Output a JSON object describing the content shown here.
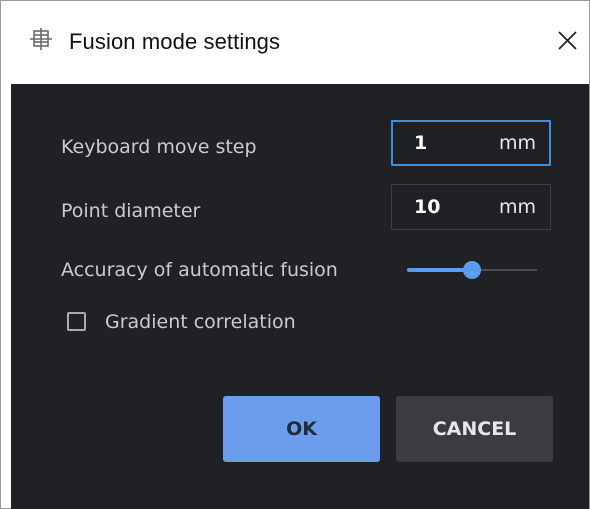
{
  "dialog": {
    "title": "Fusion mode settings",
    "icon": "fusion-crosshair-icon",
    "close_icon": "close-icon"
  },
  "fields": {
    "keyboard_move_step": {
      "label": "Keyboard move step",
      "value": "1",
      "unit": "mm"
    },
    "point_diameter": {
      "label": "Point diameter",
      "value": "10",
      "unit": "mm"
    },
    "accuracy": {
      "label": "Accuracy of automatic fusion",
      "level": 0.5
    },
    "gradient_correlation": {
      "label": "Gradient correlation",
      "checked": false
    }
  },
  "buttons": {
    "ok": "OK",
    "cancel": "CANCEL"
  },
  "colors": {
    "panel_bg": "#202124",
    "accent": "#5b9cf0",
    "ok_button": "#6c9ded",
    "cancel_button": "#3a3c40",
    "focus_border": "#3e8ed8"
  }
}
